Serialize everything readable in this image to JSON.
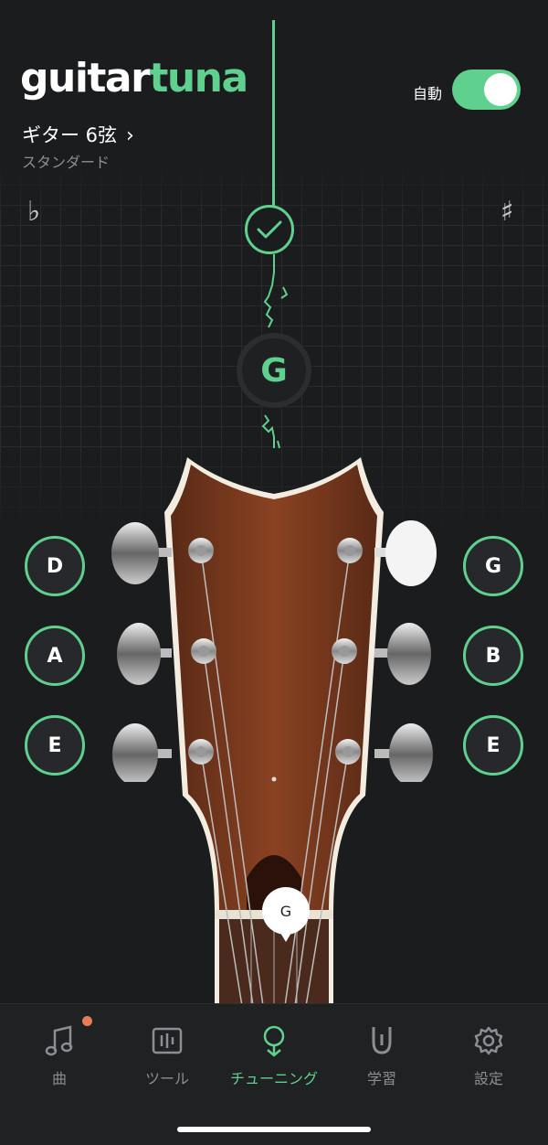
{
  "app": {
    "logo_part1": "guitar",
    "logo_part2": "tuna"
  },
  "header": {
    "instrument": "ギター 6弦",
    "tuning": "スタンダード",
    "auto_label": "自動",
    "auto_enabled": true
  },
  "meter": {
    "flat_symbol": "♭",
    "sharp_symbol": "♯",
    "detected_note": "G",
    "in_tune": true
  },
  "strings": {
    "left": [
      "D",
      "A",
      "E"
    ],
    "right": [
      "G",
      "B",
      "E"
    ],
    "current": "G"
  },
  "tabs": [
    {
      "label": "曲",
      "icon": "music-note-icon",
      "badge": true
    },
    {
      "label": "ツール",
      "icon": "tools-icon"
    },
    {
      "label": "チューニング",
      "icon": "tuning-fork-icon",
      "active": true
    },
    {
      "label": "学習",
      "icon": "learn-icon"
    },
    {
      "label": "設定",
      "icon": "gear-icon"
    }
  ],
  "colors": {
    "accent": "#5fd08e",
    "background": "#1b1c1e",
    "badge": "#e67d55"
  }
}
